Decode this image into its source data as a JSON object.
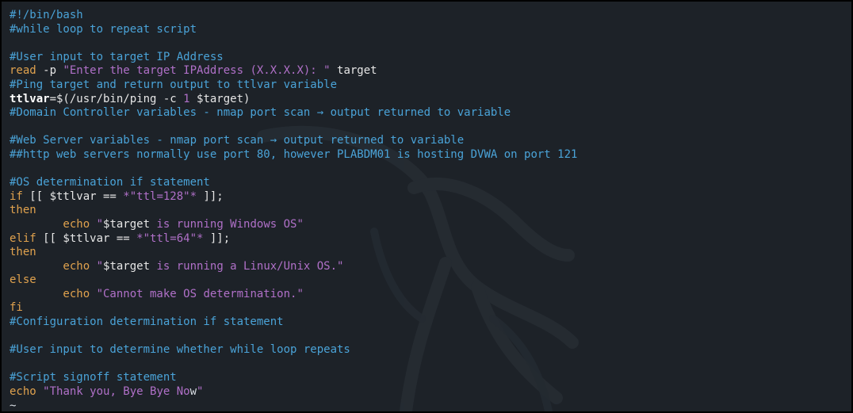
{
  "editor": {
    "lines": [
      {
        "segments": [
          {
            "t": "#!/bin/bash",
            "c": "comment"
          }
        ]
      },
      {
        "segments": [
          {
            "t": "#while loop to repeat script",
            "c": "comment"
          }
        ]
      },
      {
        "segments": [
          {
            "t": "",
            "c": "plain"
          }
        ]
      },
      {
        "segments": [
          {
            "t": "#User input to target IP Address",
            "c": "comment"
          }
        ]
      },
      {
        "segments": [
          {
            "t": "read",
            "c": "kw"
          },
          {
            "t": " -p ",
            "c": "plain"
          },
          {
            "t": "\"Enter the target IPAddress (X.X.X.X): \"",
            "c": "str"
          },
          {
            "t": " target",
            "c": "plain"
          }
        ]
      },
      {
        "segments": [
          {
            "t": "#Ping target and return output to ttlvar variable",
            "c": "comment"
          }
        ]
      },
      {
        "segments": [
          {
            "t": "ttlvar",
            "c": "var"
          },
          {
            "t": "=$(/usr/bin/ping -c ",
            "c": "plain"
          },
          {
            "t": "1",
            "c": "num"
          },
          {
            "t": " $target)",
            "c": "plain"
          }
        ]
      },
      {
        "segments": [
          {
            "t": "#Domain Controller variables - nmap port scan → output returned to variable",
            "c": "comment"
          }
        ]
      },
      {
        "segments": [
          {
            "t": "",
            "c": "plain"
          }
        ]
      },
      {
        "segments": [
          {
            "t": "#Web Server variables - nmap port scan → output returned to variable",
            "c": "comment"
          }
        ]
      },
      {
        "segments": [
          {
            "t": "##http web servers normally use port 80, however PLABDM01 is hosting DVWA on port 121",
            "c": "comment"
          }
        ]
      },
      {
        "segments": [
          {
            "t": "",
            "c": "plain"
          }
        ]
      },
      {
        "segments": [
          {
            "t": "#OS determination if statement",
            "c": "comment"
          }
        ]
      },
      {
        "segments": [
          {
            "t": "if",
            "c": "kw"
          },
          {
            "t": " [[ $ttlvar == ",
            "c": "plain"
          },
          {
            "t": "*\"ttl=128\"*",
            "c": "str"
          },
          {
            "t": " ]];",
            "c": "plain"
          }
        ]
      },
      {
        "segments": [
          {
            "t": "then",
            "c": "kw"
          }
        ]
      },
      {
        "segments": [
          {
            "t": "        echo ",
            "c": "kw"
          },
          {
            "t": "\"",
            "c": "str"
          },
          {
            "t": "$target",
            "c": "plain"
          },
          {
            "t": " is running Windows OS\"",
            "c": "str"
          }
        ]
      },
      {
        "segments": [
          {
            "t": "elif",
            "c": "kw"
          },
          {
            "t": " [[ $ttlvar == ",
            "c": "plain"
          },
          {
            "t": "*\"ttl=64\"*",
            "c": "str"
          },
          {
            "t": " ]];",
            "c": "plain"
          }
        ]
      },
      {
        "segments": [
          {
            "t": "then",
            "c": "kw"
          }
        ]
      },
      {
        "segments": [
          {
            "t": "        echo ",
            "c": "kw"
          },
          {
            "t": "\"",
            "c": "str"
          },
          {
            "t": "$target",
            "c": "plain"
          },
          {
            "t": " is running a Linux/Unix OS.\"",
            "c": "str"
          }
        ]
      },
      {
        "segments": [
          {
            "t": "else",
            "c": "kw"
          }
        ]
      },
      {
        "segments": [
          {
            "t": "        echo ",
            "c": "kw"
          },
          {
            "t": "\"Cannot make OS determination.\"",
            "c": "str"
          }
        ]
      },
      {
        "segments": [
          {
            "t": "fi",
            "c": "kw"
          }
        ]
      },
      {
        "segments": [
          {
            "t": "#Configuration determination if statement",
            "c": "comment"
          }
        ]
      },
      {
        "segments": [
          {
            "t": "",
            "c": "plain"
          }
        ]
      },
      {
        "segments": [
          {
            "t": "#User input to determine whether while loop repeats",
            "c": "comment"
          }
        ]
      },
      {
        "segments": [
          {
            "t": "",
            "c": "plain"
          }
        ]
      },
      {
        "segments": [
          {
            "t": "#Script signoff statement",
            "c": "comment"
          }
        ]
      },
      {
        "segments": [
          {
            "t": "echo ",
            "c": "kw"
          },
          {
            "t": "\"Thank you, Bye Bye No",
            "c": "str"
          },
          {
            "t": "w",
            "c": "cursor"
          },
          {
            "t": "\"",
            "c": "str"
          }
        ]
      },
      {
        "segments": [
          {
            "t": "~",
            "c": "tilde"
          }
        ]
      }
    ]
  },
  "colors": {
    "background": "#1d2228",
    "comment": "#4aa3d8",
    "keyword": "#e0a24e",
    "string": "#b070c8",
    "cursor": "#b040d0"
  }
}
